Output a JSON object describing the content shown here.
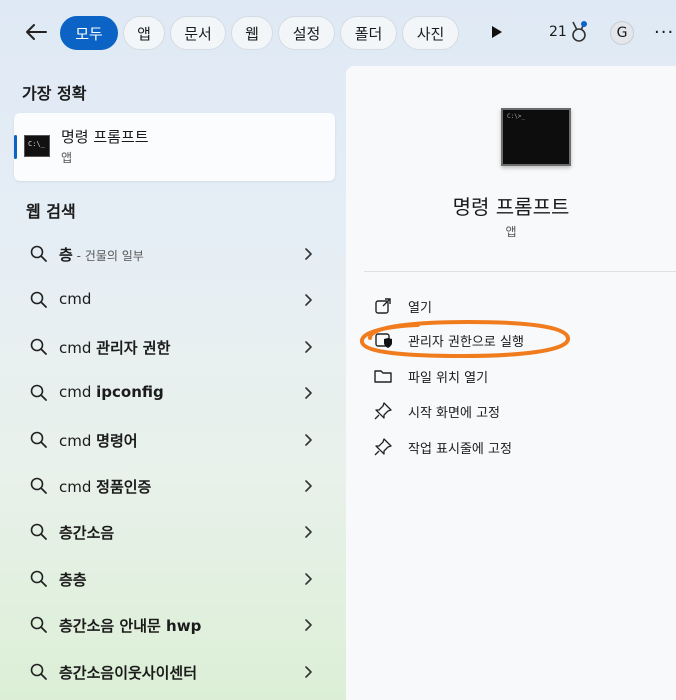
{
  "topbar": {
    "tabs": [
      "모두",
      "앱",
      "문서",
      "웹",
      "설정",
      "폴더",
      "사진"
    ],
    "active_tab": 0,
    "points": "21",
    "account_initial": "G",
    "more": "···"
  },
  "best_match": {
    "title": "가장 정확",
    "name": "명령 프롬프트",
    "type": "앱",
    "icon_text": "C:\\_"
  },
  "web_search": {
    "title": "웹 검색",
    "items": [
      {
        "bold": "층",
        "normal": "",
        "muted": " - 건물의 일부"
      },
      {
        "bold": "",
        "normal": "cmd",
        "muted": ""
      },
      {
        "normal": "cmd ",
        "bold": "관리자 권한",
        "muted": ""
      },
      {
        "normal": "cmd ",
        "bold": "ipconfig",
        "muted": ""
      },
      {
        "normal": "cmd ",
        "bold": "명령어",
        "muted": ""
      },
      {
        "normal": "cmd ",
        "bold": "정품인증",
        "muted": ""
      },
      {
        "normal": "",
        "bold": "층간소음",
        "muted": ""
      },
      {
        "normal": "",
        "bold": "층층",
        "muted": ""
      },
      {
        "normal": "",
        "bold": "층간소음 안내문 hwp",
        "muted": ""
      },
      {
        "normal": "",
        "bold": "층간소음이웃사이센터",
        "muted": ""
      }
    ]
  },
  "detail": {
    "name": "명령 프롬프트",
    "type": "앱",
    "actions": [
      {
        "label": "열기",
        "icon": "open-external-icon"
      },
      {
        "label": "관리자 권한으로 실행",
        "icon": "shield-run-icon"
      },
      {
        "label": "파일 위치 열기",
        "icon": "folder-icon"
      },
      {
        "label": "시작 화면에 고정",
        "icon": "pin-icon"
      },
      {
        "label": "작업 표시줄에 고정",
        "icon": "pin-icon"
      }
    ]
  },
  "colors": {
    "accent": "#0b63c5",
    "highlight_circle": "#f07c1e"
  }
}
